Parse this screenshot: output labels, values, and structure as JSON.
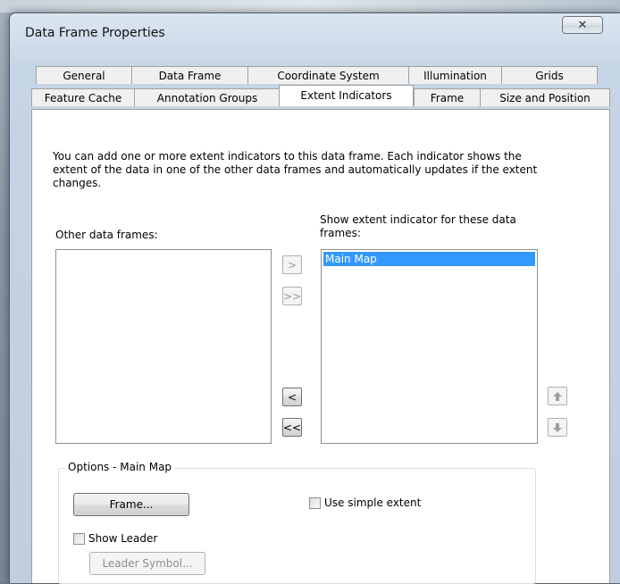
{
  "window": {
    "title": "Data Frame Properties",
    "close_glyph": "✕"
  },
  "tabs_row1": [
    "General",
    "Data Frame",
    "Coordinate System",
    "Illumination",
    "Grids"
  ],
  "tabs_row2": [
    "Feature Cache",
    "Annotation Groups",
    "Extent Indicators",
    "Frame",
    "Size and Position"
  ],
  "active_tab": "Extent Indicators",
  "panel": {
    "description": "You can add one or more extent indicators to this data frame.  Each indicator shows the extent of the data in one of the other data frames and automatically updates if the extent changes.",
    "other_frames_label": "Other data frames:",
    "show_extent_label": "Show extent indicator for these data frames:",
    "other_frames_items": [],
    "show_extent_items": [
      "Main Map"
    ],
    "buttons": {
      "add": ">",
      "add_all": ">>",
      "remove": "<",
      "remove_all": "<<"
    },
    "move_icons": {
      "up": "up-arrow-icon",
      "down": "down-arrow-icon"
    },
    "options": {
      "legend": "Options - Main Map",
      "frame_button": "Frame...",
      "use_simple_extent": "Use simple extent",
      "show_leader": "Show Leader",
      "leader_symbol_button": "Leader Symbol...",
      "use_simple_extent_checked": false,
      "show_leader_checked": false
    }
  }
}
